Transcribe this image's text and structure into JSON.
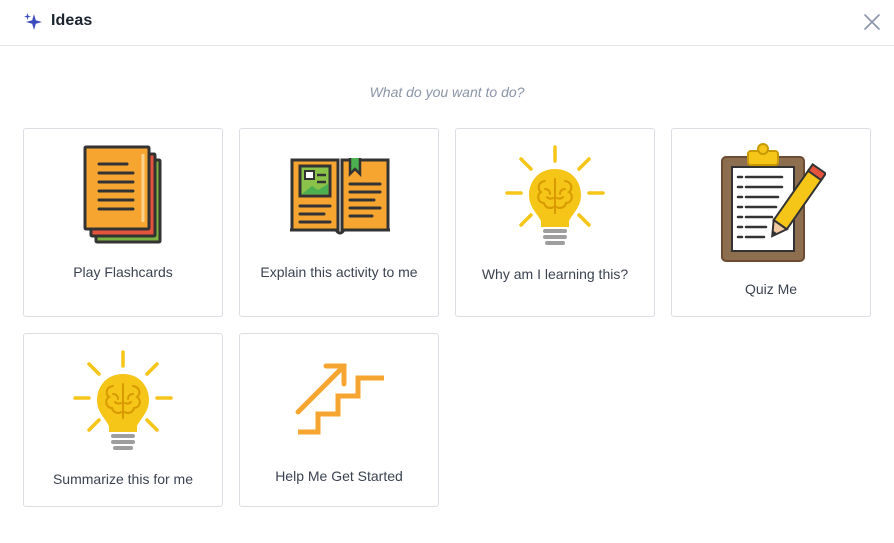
{
  "header": {
    "title": "Ideas",
    "icon": "sparkle-icon",
    "close_icon": "close-icon"
  },
  "prompt": "What do you want to do?",
  "ideas": [
    {
      "label": "Play Flashcards",
      "icon": "flashcards-icon"
    },
    {
      "label": "Explain this activity to me",
      "icon": "open-book-icon"
    },
    {
      "label": "Why am I learning this?",
      "icon": "lightbulb-brain-icon"
    },
    {
      "label": "Quiz Me",
      "icon": "clipboard-pencil-icon"
    },
    {
      "label": "Summarize this for me",
      "icon": "lightbulb-brain-icon"
    },
    {
      "label": "Help Me Get Started",
      "icon": "stairs-arrow-icon"
    }
  ],
  "colors": {
    "accent": "#3b4cc0",
    "orange": "#f7a531",
    "yellow": "#f5c518",
    "border": "#dadde2"
  }
}
